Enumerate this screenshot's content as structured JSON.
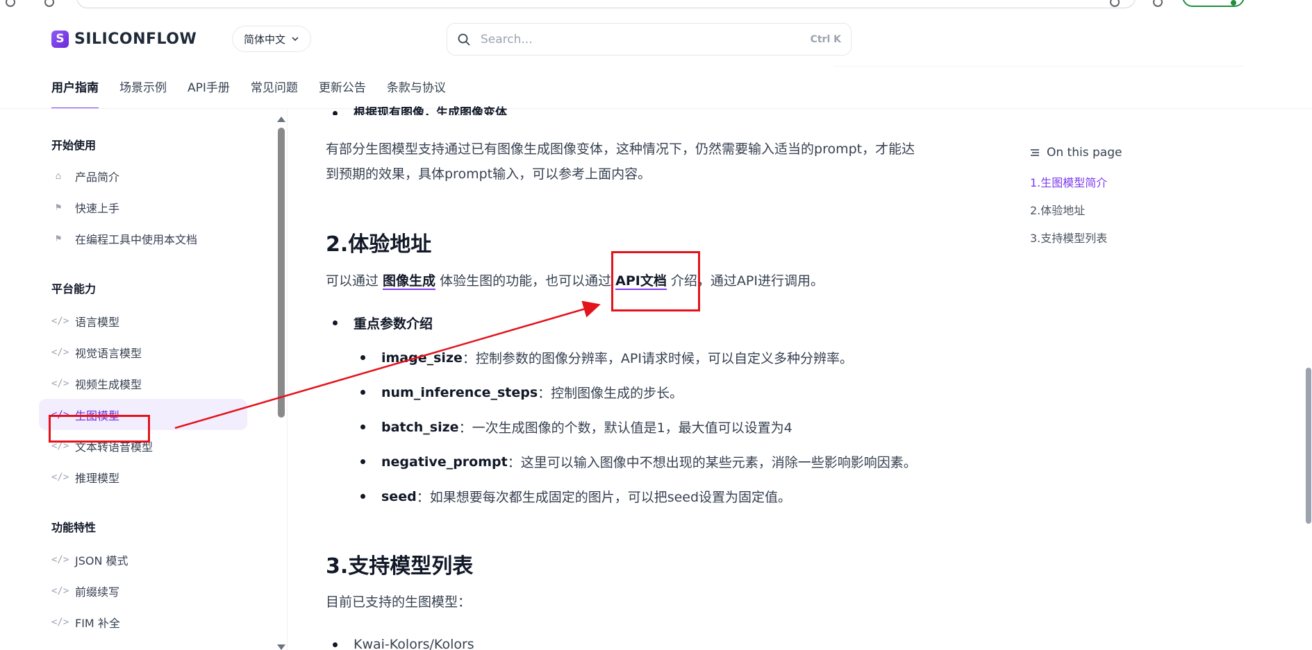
{
  "header": {
    "logo_text": "SILICONFLOW",
    "logo_mark": "S",
    "language": "简体中文",
    "search_placeholder": "Search...",
    "search_shortcut": "Ctrl K"
  },
  "nav_tabs": [
    {
      "label": "用户指南",
      "active": true
    },
    {
      "label": "场景示例"
    },
    {
      "label": "API手册"
    },
    {
      "label": "常见问题"
    },
    {
      "label": "更新公告"
    },
    {
      "label": "条款与协议"
    }
  ],
  "sidebar": {
    "sections": [
      {
        "title": "开始使用",
        "items": [
          {
            "label": "产品简介",
            "icon": "home-icon"
          },
          {
            "label": "快速上手",
            "icon": "flag-icon"
          },
          {
            "label": "在编程工具中使用本文档",
            "icon": "flag-icon"
          }
        ]
      },
      {
        "title": "平台能力",
        "items": [
          {
            "label": "语言模型",
            "icon": "code-icon"
          },
          {
            "label": "视觉语言模型",
            "icon": "code-icon"
          },
          {
            "label": "视频生成模型",
            "icon": "code-icon"
          },
          {
            "label": "生图模型",
            "icon": "code-icon",
            "active": true
          },
          {
            "label": "文本转语音模型",
            "icon": "code-icon"
          },
          {
            "label": "推理模型",
            "icon": "code-icon"
          }
        ]
      },
      {
        "title": "功能特性",
        "items": [
          {
            "label": "JSON 模式",
            "icon": "code-icon"
          },
          {
            "label": "前缀续写",
            "icon": "code-icon"
          },
          {
            "label": "FIM 补全",
            "icon": "code-icon"
          }
        ]
      }
    ]
  },
  "content": {
    "cut_bullet": "根据现有图像，生成图像变体",
    "intro_line1": "有部分生图模型支持通过已有图像生成图像变体，这种情况下，仍然需要输入适当的prompt，才能达",
    "intro_line2": "到预期的效果，具体prompt输入，可以参考上面内容。",
    "section2_title": "2.体验地址",
    "section2_text_a": "可以通过 ",
    "section2_link1": "图像生成",
    "section2_text_b": " 体验生图的功能，也可以通过 ",
    "section2_link2": "API文档",
    "section2_text_c": " 介绍，通过API进行调用。",
    "params_title": "重点参数介绍",
    "params": [
      {
        "name": "image_size",
        "desc": "：控制参数的图像分辨率，API请求时候，可以自定义多种分辨率。"
      },
      {
        "name": "num_inference_steps",
        "desc": "：控制图像生成的步长。"
      },
      {
        "name": "batch_size",
        "desc": "：一次生成图像的个数，默认值是1，最大值可以设置为4"
      },
      {
        "name": "negative_prompt",
        "desc": "：这里可以输入图像中不想出现的某些元素，消除一些影响影响因素。"
      },
      {
        "name": "seed",
        "desc": "：如果想要每次都生成固定的图片，可以把seed设置为固定值。"
      }
    ],
    "section3_title": "3.支持模型列表",
    "section3_text": "目前已支持的生图模型：",
    "model_first": "Kwai-Kolors/Kolors"
  },
  "toc": {
    "heading": "On this page",
    "items": [
      {
        "label": "1.生图模型简介",
        "active": true
      },
      {
        "label": "2.体验地址"
      },
      {
        "label": "3.支持模型列表"
      }
    ]
  },
  "colors": {
    "accent": "#7c3aed",
    "annotation": "#e3121b",
    "active_bg": "#f3eefe"
  }
}
